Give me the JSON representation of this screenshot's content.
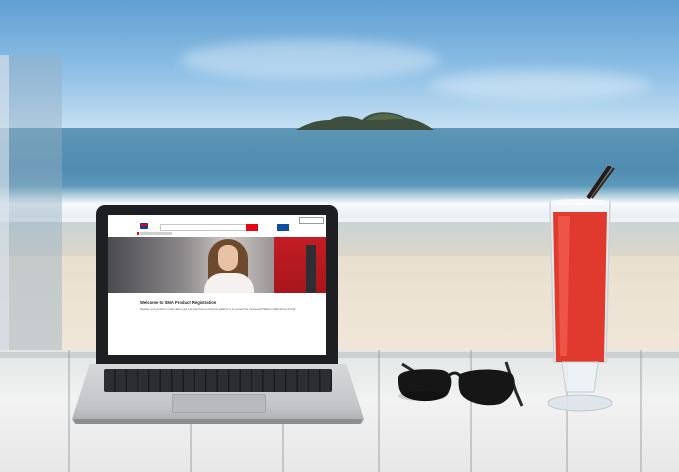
{
  "scene": {
    "description_label": "beach-desk-photo"
  },
  "laptop_screen": {
    "site_title": "Welcome to SMA Product Registration",
    "intro_text": "Register your product in order take to get it at hand from a customer platform or to connect the Connected Platform (SMA Sunny Portal).",
    "breadcrumb": "Product Registration"
  },
  "colors": {
    "brand_red": "#e30613",
    "brand_blue": "#0b4ea2",
    "logo_blue": "#1b3a8a"
  },
  "icons": {
    "logo": "sma-logo-icon",
    "search": "search-icon"
  }
}
